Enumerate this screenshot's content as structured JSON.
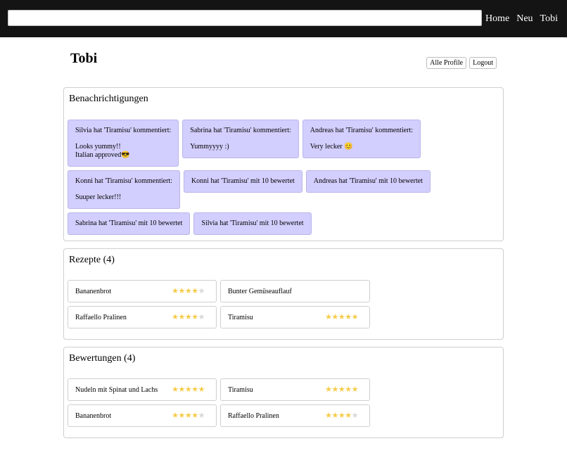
{
  "nav": {
    "search": {
      "value": "",
      "placeholder": ""
    },
    "links": [
      "Home",
      "Neu",
      "Tobi"
    ]
  },
  "profile": {
    "name": "Tobi",
    "buttons": {
      "all_profiles": "Alle Profile",
      "logout": "Logout"
    }
  },
  "notifications": {
    "title": "Benachrichtigungen",
    "rows": [
      [
        {
          "head": "Silvia hat 'Tiramisu' kommentiert:",
          "body": "Looks yummy!!\nItalian approved😎"
        },
        {
          "head": "Sabrina hat 'Tiramisu' kommentiert:",
          "body": "Yummyyyy :)"
        },
        {
          "head": "Andreas hat 'Tiramisu' kommentiert:",
          "body": "Very lecker 😊"
        }
      ],
      [
        {
          "head": "Konni hat 'Tiramisu' kommentiert:",
          "body": "Suuper lecker!!!"
        },
        {
          "head": "Konni hat 'Tiramisu' mit 10 bewertet",
          "body": ""
        },
        {
          "head": "Andreas hat 'Tiramisu' mit 10 bewertet",
          "body": ""
        }
      ],
      [
        {
          "head": "Sabrina hat 'Tiramisu' mit 10 bewertet",
          "body": ""
        },
        {
          "head": "Silvia hat 'Tiramisu' mit 10 bewertet",
          "body": ""
        }
      ]
    ]
  },
  "recipes": {
    "title": "Rezepte (4)",
    "items": [
      {
        "name": "Bananenbrot",
        "rating": 4
      },
      {
        "name": "Bunter Gemüseauflauf",
        "rating": 0
      },
      {
        "name": "Raffaello Pralinen",
        "rating": 4
      },
      {
        "name": "Tiramisu",
        "rating": 5
      }
    ]
  },
  "ratings": {
    "title": "Bewertungen (4)",
    "items": [
      {
        "name": "Nudeln mit Spinat und Lachs",
        "rating": 5
      },
      {
        "name": "Tiramisu",
        "rating": 5
      },
      {
        "name": "Bananenbrot",
        "rating": 4
      },
      {
        "name": "Raffaello Pralinen",
        "rating": 4
      }
    ]
  },
  "colors": {
    "topbar": "#141414",
    "notification": "#d2cffe",
    "star_on": "#f5cc4a",
    "star_off": "#d7d7d7"
  }
}
